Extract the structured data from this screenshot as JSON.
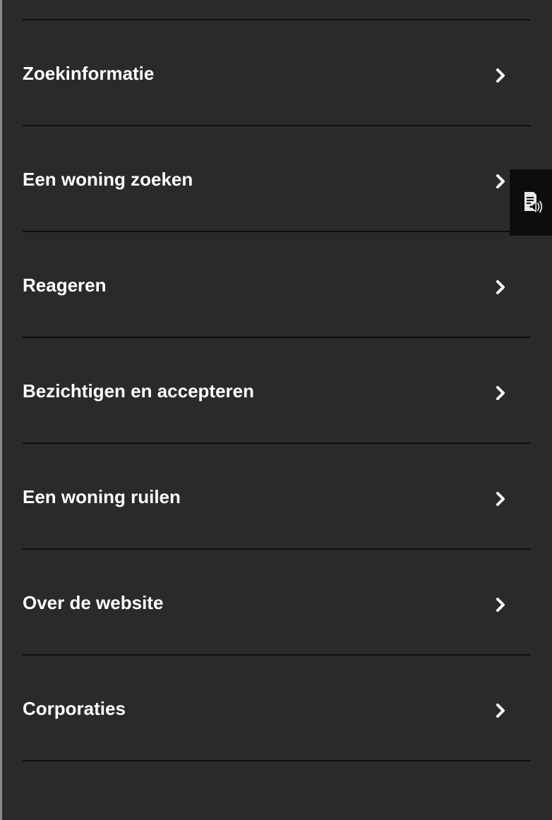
{
  "menu": {
    "items": [
      {
        "label": "Zoekinformatie"
      },
      {
        "label": "Een woning zoeken"
      },
      {
        "label": "Reageren"
      },
      {
        "label": "Bezichtigen en accepteren"
      },
      {
        "label": "Een woning ruilen"
      },
      {
        "label": "Over de website"
      },
      {
        "label": "Corporaties"
      }
    ],
    "chevron_icon": "chevron-right-icon"
  },
  "readspeaker": {
    "icon": "read-aloud-icon"
  },
  "colors": {
    "background": "#2a2a2a",
    "divider": "#0f0f0f",
    "text": "#ffffff",
    "readspeaker_bg": "#0d0d0d"
  }
}
